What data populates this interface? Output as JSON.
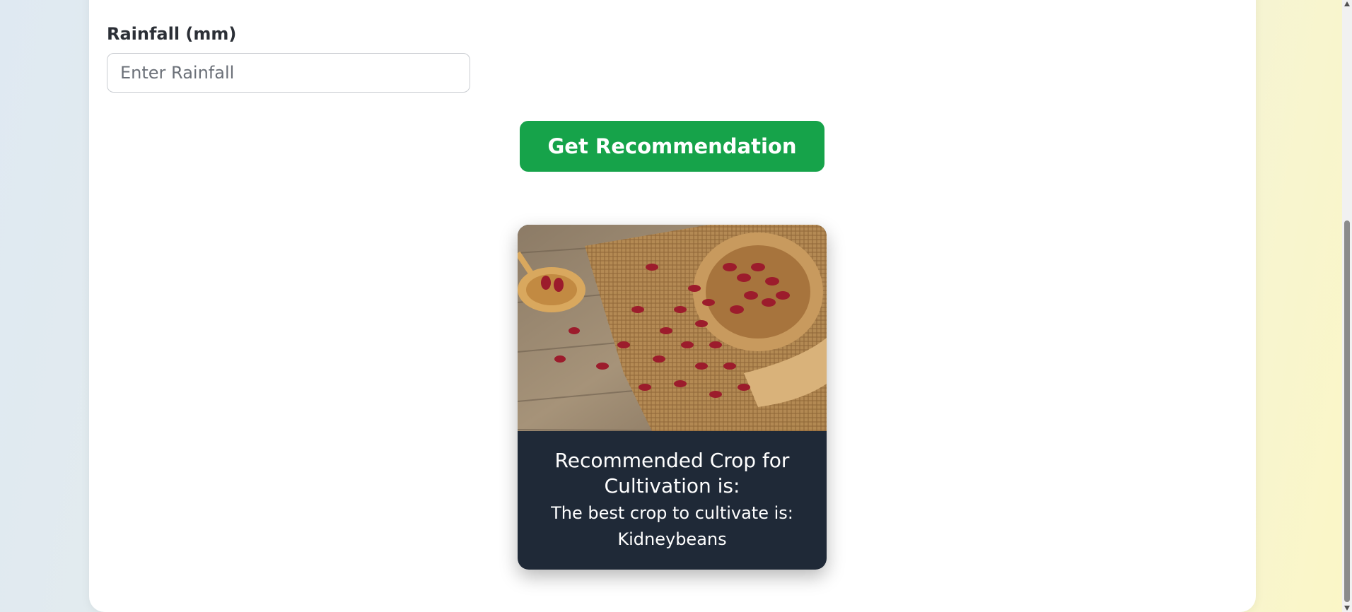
{
  "form": {
    "rainfall_label": "Rainfall (mm)",
    "rainfall_placeholder": "Enter Rainfall",
    "rainfall_value": "",
    "submit_label": "Get Recommendation"
  },
  "result": {
    "heading": "Recommended Crop for Cultivation is:",
    "line": "The best crop to cultivate is:",
    "crop": "Kidneybeans",
    "image_icon": "kidney-beans-photo"
  },
  "colors": {
    "accent": "#16a34a",
    "result_panel": "#1f2937",
    "card": "#ffffff"
  }
}
